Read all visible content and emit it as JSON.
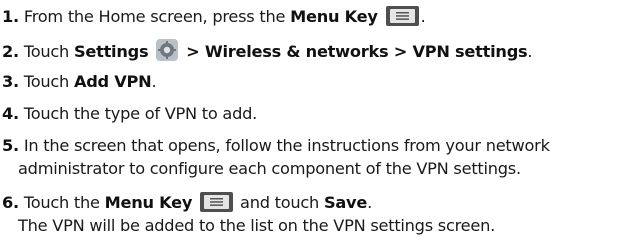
{
  "steps": [
    {
      "num": "1.",
      "text": "From the Home screen, press the ",
      "bold": "Menu Key",
      "icon": "menu-key-icon"
    },
    {
      "num": "2.",
      "text": "Touch ",
      "bold1": "Settings",
      "icon": "settings-gear-icon",
      "bold2": "> Wireless & networks > VPN settings",
      "end": "."
    },
    {
      "num": "3.",
      "text": "Touch ",
      "bold": "Add VPN",
      "end": "."
    },
    {
      "num": "4.",
      "text": "Touch the type of VPN to add."
    },
    {
      "num": "5.",
      "line1": "In the screen that opens, follow the instructions from your network",
      "line2": "administrator to configure each component of the VPN settings."
    },
    {
      "num": "6.",
      "text": "Touch the ",
      "bold1": "Menu Key",
      "icon": "menu-key-icon",
      "mid": " and touch ",
      "bold2": "Save",
      "end": ".",
      "line2": "The VPN will be added to the list on the VPN settings screen."
    }
  ]
}
